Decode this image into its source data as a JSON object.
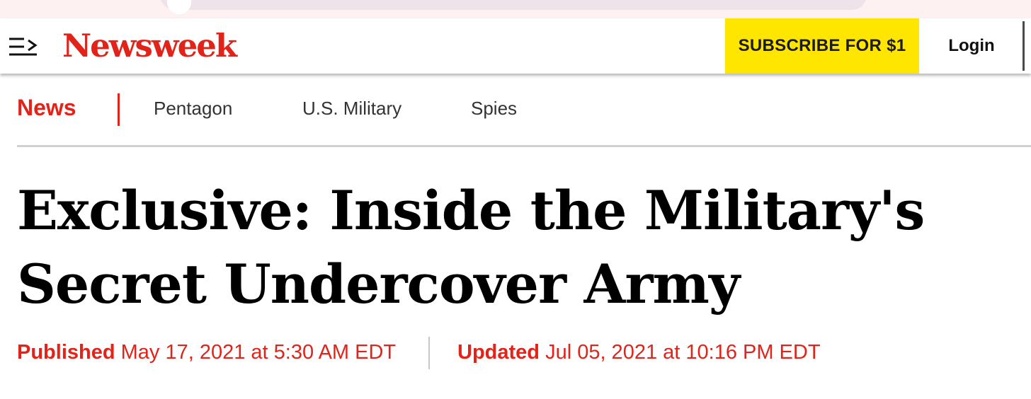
{
  "site": {
    "logo_text": "Newsweek",
    "subscribe_label": "SUBSCRIBE FOR $1",
    "login_label": "Login",
    "brand_color": "#e2231a",
    "subscribe_bg": "#ffe600"
  },
  "icons": {
    "menu": "menu-hamburger-arrow-icon"
  },
  "section_nav": {
    "section_label": "News",
    "links": [
      "Pentagon",
      "U.S. Military",
      "Spies"
    ]
  },
  "article": {
    "headline": "Exclusive: Inside the Military's Secret Undercover Army",
    "published_label": "Published",
    "published_date": "May 17, 2021 at 5:30 AM EDT",
    "updated_label": "Updated",
    "updated_date": "Jul 05, 2021 at 10:16 PM EDT"
  }
}
